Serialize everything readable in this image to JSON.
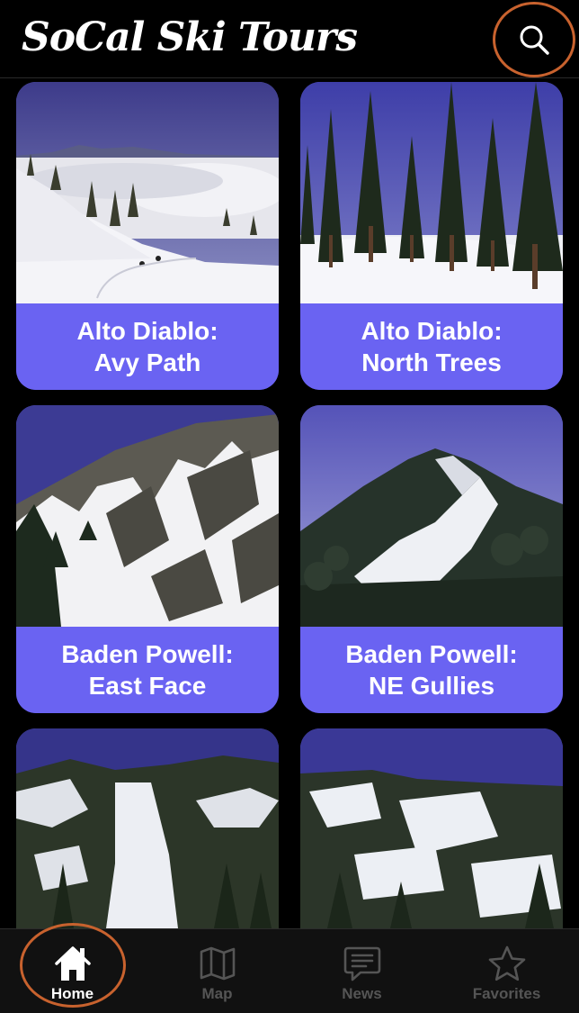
{
  "header": {
    "title": "SoCal Ski Tours",
    "search_icon": "search-icon",
    "highlight_color": "#c8622e"
  },
  "cards": [
    {
      "line1": "Alto Diablo:",
      "line2": "Avy Path",
      "photo": "snowy-slope-above-clouds"
    },
    {
      "line1": "Alto Diablo:",
      "line2": "North Trees",
      "photo": "pine-forest-snow"
    },
    {
      "line1": "Baden Powell:",
      "line2": "East Face",
      "photo": "steep-rocky-face"
    },
    {
      "line1": "Baden Powell:",
      "line2": "NE Gullies",
      "photo": "forested-peak-gullies"
    },
    {
      "line1": "",
      "line2": "",
      "photo": "snow-chute-between-trees"
    },
    {
      "line1": "",
      "line2": "",
      "photo": "treed-snowy-slope"
    }
  ],
  "card_color": "#6a63f2",
  "tabs": [
    {
      "label": "Home",
      "icon": "home-icon",
      "active": true
    },
    {
      "label": "Map",
      "icon": "map-icon",
      "active": false
    },
    {
      "label": "News",
      "icon": "news-icon",
      "active": false
    },
    {
      "label": "Favorites",
      "icon": "star-icon",
      "active": false
    }
  ]
}
